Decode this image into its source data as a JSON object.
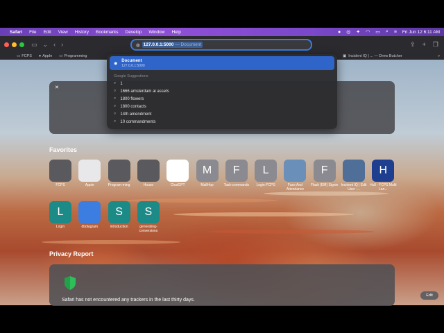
{
  "menubar": {
    "app": "Safari",
    "items": [
      "File",
      "Edit",
      "View",
      "History",
      "Bookmarks",
      "Develop",
      "Window",
      "Help"
    ],
    "datetime": "Fri Jun 12  6:11 AM"
  },
  "toolbar": {
    "url": "127.0.0.1:5000",
    "url_suffix": "— Document"
  },
  "bookmarks": {
    "items": [
      "FCPS",
      "Apple",
      "Programming"
    ],
    "right": "Incident IQ | ... — Drew Butcher"
  },
  "dropdown": {
    "top_title": "Document",
    "top_url": "127.0.0.1:5000",
    "heading": "Google Suggestions",
    "suggestions": [
      "1",
      "1666 amsterdam ai assets",
      "1800 flowers",
      "1800 contacts",
      "14th amendment",
      "10 commandments"
    ]
  },
  "favorites": {
    "title": "Favorites",
    "row1": [
      {
        "label": "FCPS",
        "letter": "",
        "color": "#5a5a5e"
      },
      {
        "label": "Apple",
        "letter": "",
        "color": "#e8e8ea"
      },
      {
        "label": "Program-ming",
        "letter": "",
        "color": "#5a5a5e"
      },
      {
        "label": "House",
        "letter": "",
        "color": "#5a5a5e"
      },
      {
        "label": "ChatGPT",
        "letter": "",
        "color": "#ffffff"
      },
      {
        "label": "MailHop",
        "letter": "M",
        "color": "#8a8a90"
      },
      {
        "label": "Task-commands",
        "letter": "F",
        "color": "#8a8a90"
      },
      {
        "label": "Login-FCPS",
        "letter": "L",
        "color": "#8a8a90"
      },
      {
        "label": "Face And Attendance",
        "letter": "",
        "color": "#6a8fb8"
      },
      {
        "label": "Flask (EM) Signin",
        "letter": "F",
        "color": "#8a8a90"
      },
      {
        "label": "Incident IQ | Edit User -...",
        "letter": "",
        "color": "#4f6f99"
      },
      {
        "label": "Hull - FCPS Multi Lan...",
        "letter": "H",
        "color": "#1e3f8f"
      }
    ],
    "row2": [
      {
        "label": "Login",
        "letter": "L",
        "color": "#1c8a86"
      },
      {
        "label": "dbdiagram",
        "letter": "",
        "color": "#3b7de0"
      },
      {
        "label": "introduction",
        "letter": "S",
        "color": "#1c8a86"
      },
      {
        "label": "generating-conversions",
        "letter": "S",
        "color": "#1c8a86"
      }
    ]
  },
  "privacy": {
    "title": "Privacy Report",
    "message": "Safari has not encountered any trackers in the last thirty days."
  },
  "edit_label": "Edit"
}
